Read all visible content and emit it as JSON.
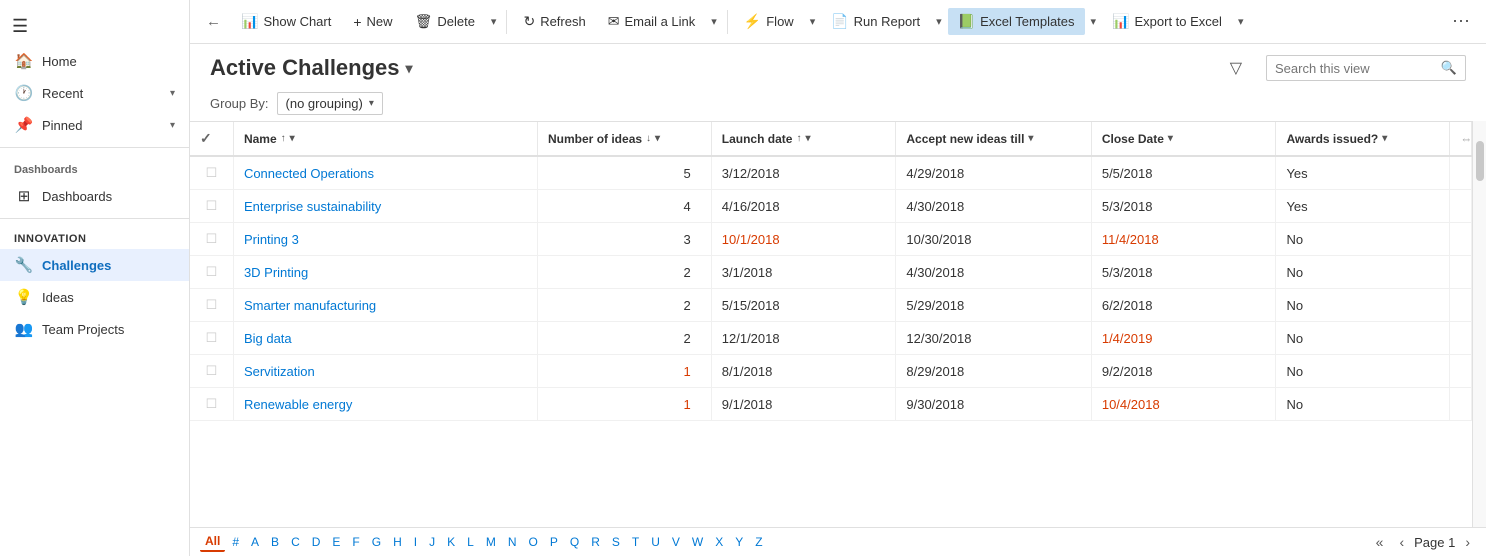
{
  "sidebar": {
    "hamburger": "☰",
    "sections": [
      {
        "items": [
          {
            "id": "home",
            "icon": "🏠",
            "label": "Home",
            "hasChevron": false
          },
          {
            "id": "recent",
            "icon": "🕐",
            "label": "Recent",
            "hasChevron": true
          },
          {
            "id": "pinned",
            "icon": "📌",
            "label": "Pinned",
            "hasChevron": true
          }
        ]
      }
    ],
    "dashboards_header": "Dashboards",
    "dashboards_items": [
      {
        "id": "dashboards",
        "icon": "⊞",
        "label": "Dashboards"
      }
    ],
    "innovation_header": "Innovation",
    "innovation_items": [
      {
        "id": "challenges",
        "icon": "🔧",
        "label": "Challenges",
        "active": true
      },
      {
        "id": "ideas",
        "icon": "💡",
        "label": "Ideas"
      },
      {
        "id": "team-projects",
        "icon": "👥",
        "label": "Team Projects"
      }
    ]
  },
  "toolbar": {
    "back_label": "←",
    "show_chart_label": "Show Chart",
    "new_label": "New",
    "delete_label": "Delete",
    "refresh_label": "Refresh",
    "email_link_label": "Email a Link",
    "flow_label": "Flow",
    "run_report_label": "Run Report",
    "excel_templates_label": "Excel Templates",
    "export_excel_label": "Export to Excel",
    "more_label": "⋯"
  },
  "header": {
    "title": "Active Challenges",
    "filter_icon": "▽",
    "search_placeholder": "Search this view",
    "search_icon": "🔍"
  },
  "groupby": {
    "label": "Group By:",
    "value": "(no grouping)"
  },
  "columns": [
    {
      "id": "name",
      "label": "Name",
      "sort": "▲",
      "hasFilter": true
    },
    {
      "id": "ideas",
      "label": "Number of ideas",
      "sort": "▼",
      "hasFilter": true
    },
    {
      "id": "launch",
      "label": "Launch date",
      "sort": "▲",
      "hasFilter": true
    },
    {
      "id": "accept",
      "label": "Accept new ideas till",
      "sort": null,
      "hasFilter": true
    },
    {
      "id": "close",
      "label": "Close Date",
      "sort": null,
      "hasFilter": true
    },
    {
      "id": "awards",
      "label": "Awards issued?",
      "sort": null,
      "hasFilter": true
    }
  ],
  "rows": [
    {
      "name": "Connected Operations",
      "name_color": "link",
      "ideas": "5",
      "ideas_color": "normal",
      "launch": "3/12/2018",
      "launch_color": "normal",
      "accept": "4/29/2018",
      "accept_color": "normal",
      "close": "5/5/2018",
      "close_color": "normal",
      "awards": "Yes",
      "awards_color": "normal"
    },
    {
      "name": "Enterprise sustainability",
      "name_color": "link",
      "ideas": "4",
      "ideas_color": "normal",
      "launch": "4/16/2018",
      "launch_color": "normal",
      "accept": "4/30/2018",
      "accept_color": "normal",
      "close": "5/3/2018",
      "close_color": "normal",
      "awards": "Yes",
      "awards_color": "normal"
    },
    {
      "name": "Printing 3",
      "name_color": "link",
      "ideas": "3",
      "ideas_color": "normal",
      "launch": "10/1/2018",
      "launch_color": "orange",
      "accept": "10/30/2018",
      "accept_color": "normal",
      "close": "11/4/2018",
      "close_color": "orange",
      "awards": "No",
      "awards_color": "normal"
    },
    {
      "name": "3D Printing",
      "name_color": "link",
      "ideas": "2",
      "ideas_color": "normal",
      "launch": "3/1/2018",
      "launch_color": "normal",
      "accept": "4/30/2018",
      "accept_color": "normal",
      "close": "5/3/2018",
      "close_color": "normal",
      "awards": "No",
      "awards_color": "normal"
    },
    {
      "name": "Smarter manufacturing",
      "name_color": "link",
      "ideas": "2",
      "ideas_color": "normal",
      "launch": "5/15/2018",
      "launch_color": "normal",
      "accept": "5/29/2018",
      "accept_color": "normal",
      "close": "6/2/2018",
      "close_color": "normal",
      "awards": "No",
      "awards_color": "normal"
    },
    {
      "name": "Big data",
      "name_color": "link",
      "ideas": "2",
      "ideas_color": "normal",
      "launch": "12/1/2018",
      "launch_color": "normal",
      "accept": "12/30/2018",
      "accept_color": "normal",
      "close": "1/4/2019",
      "close_color": "orange",
      "awards": "No",
      "awards_color": "normal"
    },
    {
      "name": "Servitization",
      "name_color": "link",
      "ideas": "1",
      "ideas_color": "orange",
      "launch": "8/1/2018",
      "launch_color": "normal",
      "accept": "8/29/2018",
      "accept_color": "normal",
      "close": "9/2/2018",
      "close_color": "normal",
      "awards": "No",
      "awards_color": "normal"
    },
    {
      "name": "Renewable energy",
      "name_color": "link",
      "ideas": "1",
      "ideas_color": "orange",
      "launch": "9/1/2018",
      "launch_color": "normal",
      "accept": "9/30/2018",
      "accept_color": "normal",
      "close": "10/4/2018",
      "close_color": "orange",
      "awards": "No",
      "awards_color": "normal"
    }
  ],
  "alphabet_bar": {
    "active": "All",
    "items": [
      "All",
      "#",
      "A",
      "B",
      "C",
      "D",
      "E",
      "F",
      "G",
      "H",
      "I",
      "J",
      "K",
      "L",
      "M",
      "N",
      "O",
      "P",
      "Q",
      "R",
      "S",
      "T",
      "U",
      "V",
      "W",
      "X",
      "Y",
      "Z"
    ]
  },
  "pagination": {
    "page_label": "Page 1",
    "prev_page": "‹",
    "next_page": "›",
    "first_page": "«",
    "last_page": "»"
  }
}
